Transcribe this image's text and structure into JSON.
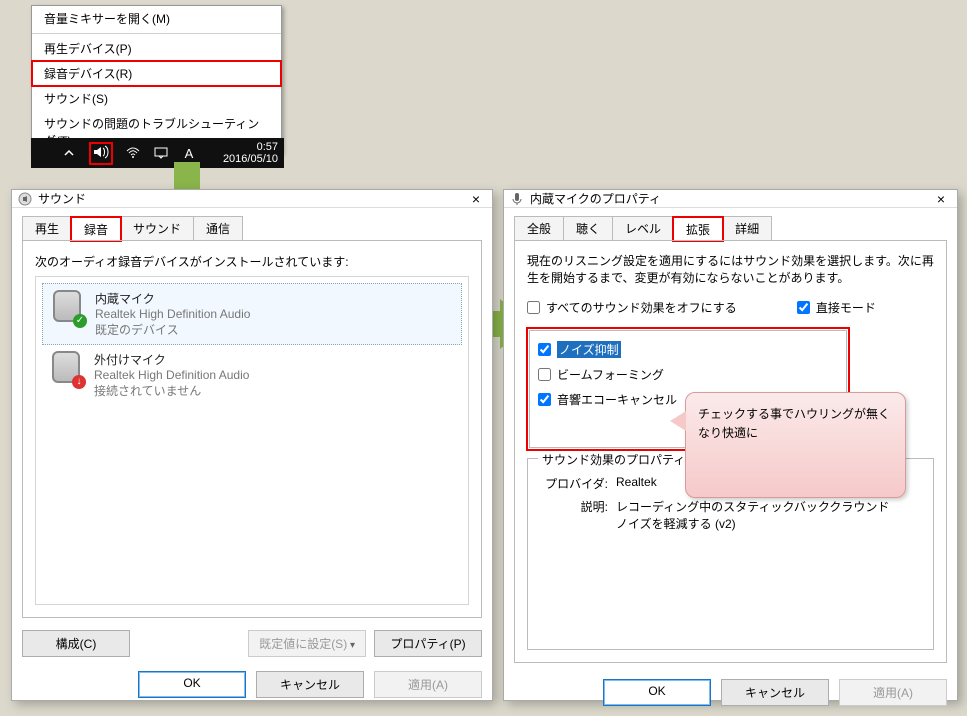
{
  "context_menu": {
    "items": [
      "音量ミキサーを開く(M)",
      "再生デバイス(P)",
      "録音デバイス(R)",
      "サウンド(S)",
      "サウンドの問題のトラブルシューティング(T)"
    ],
    "highlighted_index": 2
  },
  "taskbar": {
    "time": "0:57",
    "date": "2016/05/10"
  },
  "sound_window": {
    "title": "サウンド",
    "tabs": [
      "再生",
      "録音",
      "サウンド",
      "通信"
    ],
    "active_tab": 1,
    "description": "次のオーディオ録音デバイスがインストールされています:",
    "devices": [
      {
        "name": "内蔵マイク",
        "driver": "Realtek High Definition Audio",
        "status": "既定のデバイス",
        "state": "ok",
        "selected": true
      },
      {
        "name": "外付けマイク",
        "driver": "Realtek High Definition Audio",
        "status": "接続されていません",
        "state": "down",
        "selected": false
      }
    ],
    "buttons": {
      "configure": "構成(C)",
      "set_default": "既定値に設定(S)",
      "properties": "プロパティ(P)",
      "ok": "OK",
      "cancel": "キャンセル",
      "apply": "適用(A)"
    }
  },
  "prop_window": {
    "title": "内蔵マイクのプロパティ",
    "tabs": [
      "全般",
      "聴く",
      "レベル",
      "拡張",
      "詳細"
    ],
    "active_tab": 3,
    "description": "現在のリスニング設定を適用にするにはサウンド効果を選択します。次に再生を開始するまで、変更が有効にならないことがあります。",
    "disable_all": {
      "label": "すべてのサウンド効果をオフにする",
      "checked": false
    },
    "direct_mode": {
      "label": "直接モード",
      "checked": true
    },
    "effects": [
      {
        "label": "ノイズ抑制",
        "checked": true,
        "selected": true
      },
      {
        "label": "ビームフォーミング",
        "checked": false,
        "selected": false
      },
      {
        "label": "音響エコーキャンセル",
        "checked": true,
        "selected": false
      }
    ],
    "effect_props": {
      "legend": "サウンド効果のプロパティ",
      "provider_label": "プロバイダ:",
      "provider_value": "Realtek",
      "desc_label": "説明:",
      "desc_value": "レコーディング中のスタティックバッククラウンドノイズを軽減する (v2)"
    },
    "buttons": {
      "ok": "OK",
      "cancel": "キャンセル",
      "apply": "適用(A)"
    }
  },
  "callout": {
    "text": "チェックする事でハウリングが無くなり快適に"
  }
}
